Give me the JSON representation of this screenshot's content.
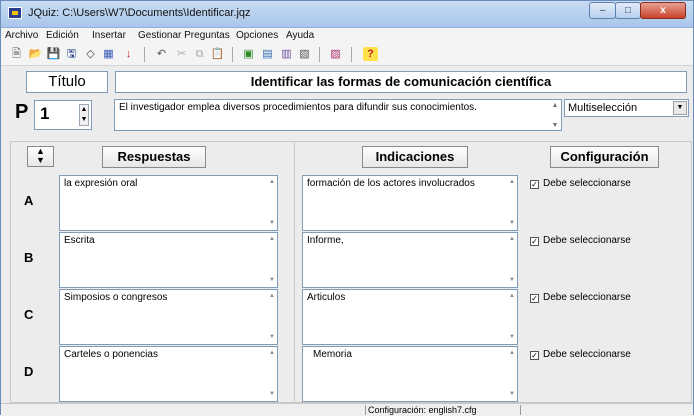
{
  "window": {
    "title": "JQuiz: C:\\Users\\W7\\Documents\\Identificar.jqz",
    "min_glyph": "–",
    "max_glyph": "□",
    "close_glyph": "x"
  },
  "menu": [
    "Archivo",
    "Edición",
    "Insertar",
    "Gestionar Preguntas",
    "Opciones",
    "Ayuda"
  ],
  "toolbar": {
    "icons": [
      "new-file-icon",
      "open-folder-icon",
      "save-icon",
      "save-as-icon",
      "eraser-icon",
      "grid-icon",
      "down-arrow-icon",
      "undo-icon",
      "cut-icon",
      "copy-icon",
      "paste-icon",
      "web-export-icon",
      "export-icon",
      "jcloze-icon",
      "jmix-icon",
      "add-picture-icon",
      "help-icon"
    ],
    "glyphs": [
      "🗎",
      "📂",
      "💾",
      "🖫",
      "◇",
      "▦",
      "↓",
      "↶",
      "✂",
      "⧉",
      "📋",
      "▣",
      "▤",
      "▥",
      "▧",
      "▨",
      "?"
    ]
  },
  "titulo_label": "Título",
  "title_value": "Identificar las formas de comunicación científica",
  "question": {
    "letter": "P",
    "number": "1",
    "text": "El investigador emplea diversos procedimientos para difundir sus conocimientos.",
    "type": "Multiselección"
  },
  "headers": {
    "respuestas": "Respuestas",
    "indicaciones": "Indicaciones",
    "configuracion": "Configuración"
  },
  "rows": [
    {
      "letter": "A",
      "answer": "la expresión oral",
      "feedback": "formación de los actores involucrados",
      "check_label": "Debe seleccionarse",
      "checked": true
    },
    {
      "letter": "B",
      "answer": "Escrita",
      "feedback": "Informe,",
      "check_label": "Debe seleccionarse",
      "checked": true
    },
    {
      "letter": "C",
      "answer": "Simposios o congresos",
      "feedback": "Articulos",
      "check_label": "Debe seleccionarse",
      "checked": true
    },
    {
      "letter": "D",
      "answer": "Carteles o ponencias",
      "feedback": "Memoria",
      "check_label": "Debe seleccionarse",
      "checked": true
    }
  ],
  "status": {
    "config": "Configuración: english7.cfg"
  },
  "colors": {
    "titlebar": "#bcd3ee",
    "window_bg": "#ececec",
    "field_border": "#7f9db9",
    "close_button": "#c8432b"
  }
}
